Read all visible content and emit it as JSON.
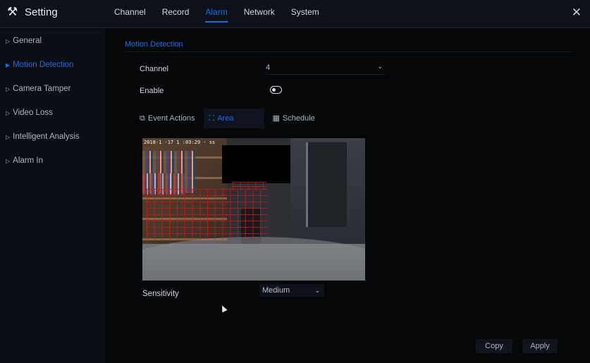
{
  "app": {
    "title": "Setting",
    "icon": "tools-icon",
    "close_icon": "close-icon"
  },
  "nav": {
    "tabs": [
      {
        "label": "Channel",
        "active": false
      },
      {
        "label": "Record",
        "active": false
      },
      {
        "label": "Alarm",
        "active": true
      },
      {
        "label": "Network",
        "active": false
      },
      {
        "label": "System",
        "active": false
      }
    ]
  },
  "sidebar": {
    "items": [
      {
        "label": "General",
        "active": false
      },
      {
        "label": "Motion Detection",
        "active": true
      },
      {
        "label": "Camera Tamper",
        "active": false
      },
      {
        "label": "Video Loss",
        "active": false
      },
      {
        "label": "Intelligent Analysis",
        "active": false
      },
      {
        "label": "Alarm In",
        "active": false
      }
    ]
  },
  "main": {
    "section_title": "Motion Detection",
    "channel": {
      "label": "Channel",
      "value": "4"
    },
    "enable": {
      "label": "Enable",
      "on": false
    },
    "subtabs": [
      {
        "label": "Event Actions",
        "icon": "event-actions-icon",
        "active": false
      },
      {
        "label": "Area",
        "icon": "area-select-icon",
        "active": true
      },
      {
        "label": "Schedule",
        "icon": "calendar-icon",
        "active": false
      }
    ],
    "camera": {
      "osd_timestamp": "2018-1 -17 1 :03:29 · ss"
    },
    "sensitivity": {
      "label": "Sensitivity",
      "value": "Medium"
    },
    "buttons": {
      "copy": "Copy",
      "apply": "Apply"
    }
  },
  "colors": {
    "accent": "#1d6fe0",
    "background": "#050608",
    "motion_grid": "#be1e1e"
  }
}
